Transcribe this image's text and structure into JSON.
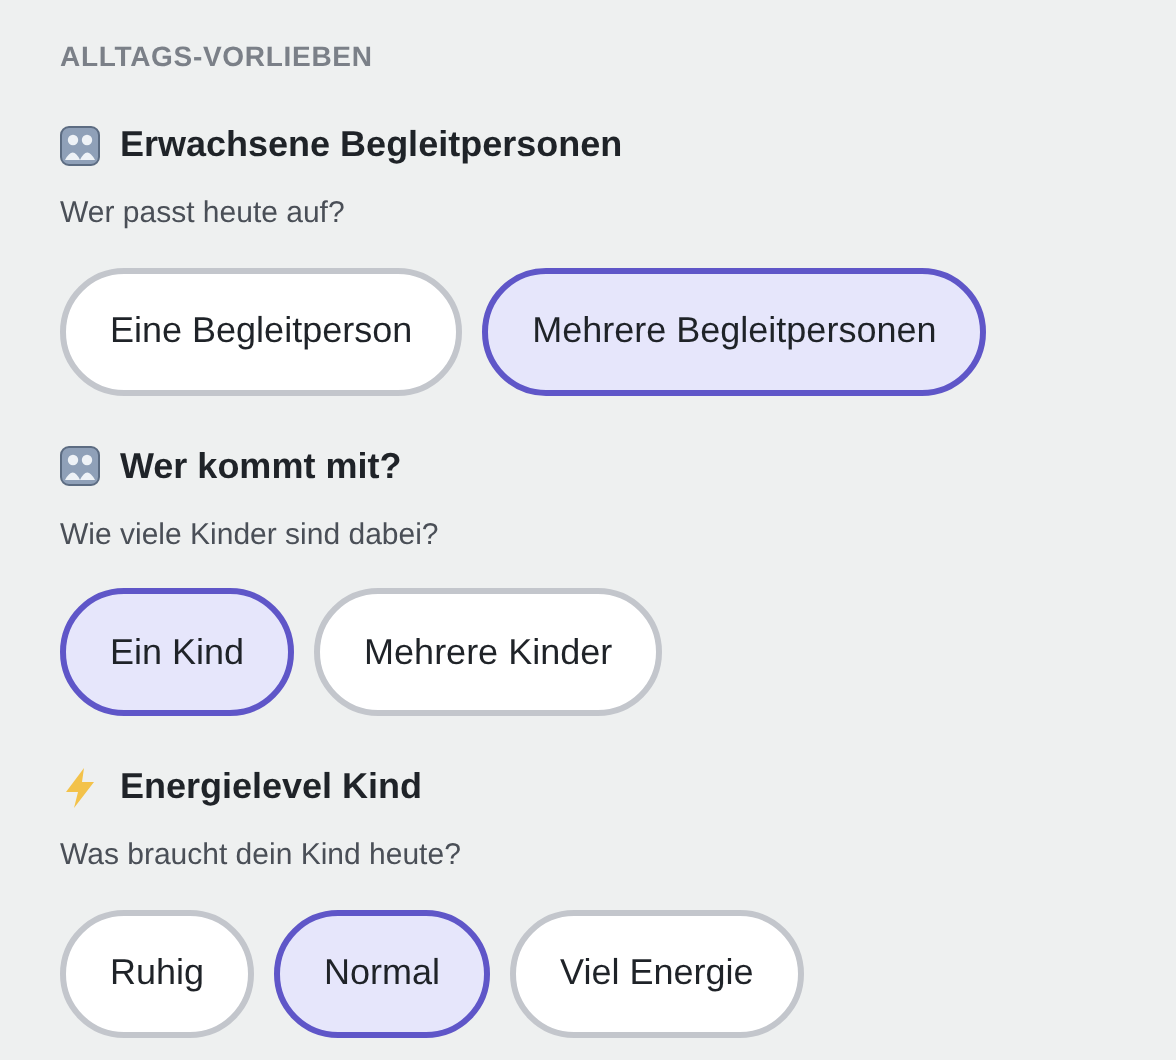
{
  "section_title": "ALLTAGS-VORLIEBEN",
  "groups": [
    {
      "kind": "people",
      "title": "Erwachsene Begleitpersonen",
      "question": "Wer passt heute auf?",
      "options": [
        {
          "label": "Eine Begleitperson",
          "selected": false
        },
        {
          "label": "Mehrere Begleitpersonen",
          "selected": true
        }
      ]
    },
    {
      "kind": "people",
      "title": "Wer kommt mit?",
      "question": "Wie viele Kinder sind dabei?",
      "options": [
        {
          "label": "Ein Kind",
          "selected": true
        },
        {
          "label": "Mehrere Kinder",
          "selected": false
        }
      ]
    },
    {
      "kind": "lightning",
      "title": "Energielevel Kind",
      "question": "Was braucht dein Kind heute?",
      "options": [
        {
          "label": "Ruhig",
          "selected": false
        },
        {
          "label": "Normal",
          "selected": true
        },
        {
          "label": "Viel Energie",
          "selected": false
        }
      ]
    }
  ]
}
